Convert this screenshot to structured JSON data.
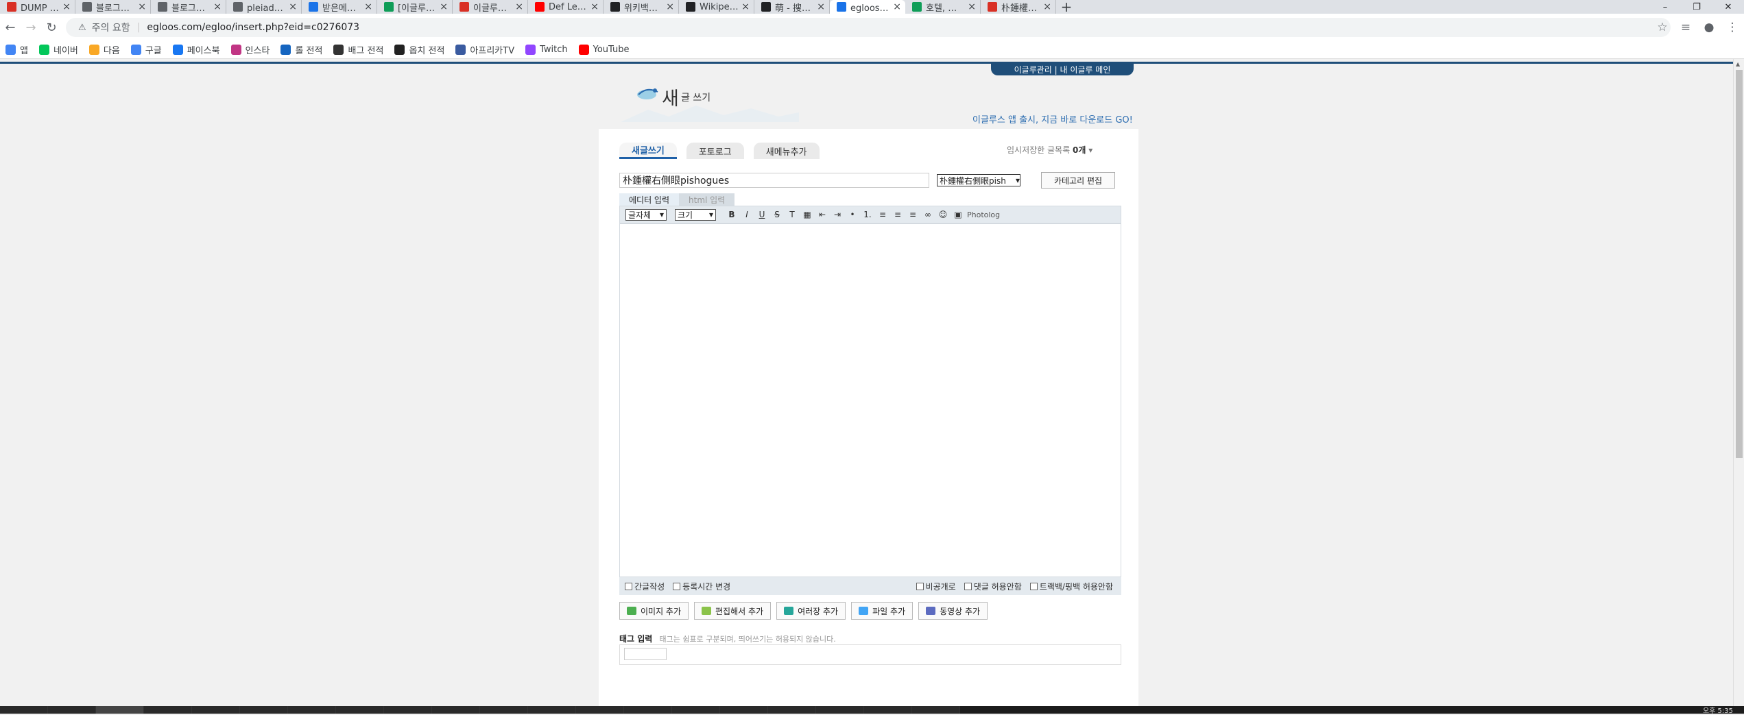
{
  "browser": {
    "tabs": [
      {
        "title": "DUMP PCK정상화",
        "color": "#d93025"
      },
      {
        "title": "블로그관리 | BLOG",
        "color": "#5f6368"
      },
      {
        "title": "블로그관리 | BLOG",
        "color": "#5f6368"
      },
      {
        "title": "pleiades聯邦紀傳",
        "color": "#5f6368"
      },
      {
        "title": "받은메일함 : Daum",
        "color": "#1a73e8"
      },
      {
        "title": "[이글루스] 확인 후",
        "color": "#0f9d58"
      },
      {
        "title": "이글루스 – 네이트",
        "color": "#d93025"
      },
      {
        "title": "Def Leppard",
        "color": "#ff0000"
      },
      {
        "title": "위키백과 – 위키백",
        "color": "#202124"
      },
      {
        "title": "Wikipedia – Wikipe",
        "color": "#202124"
      },
      {
        "title": "萌 - 搜索結果 - 維",
        "color": "#202124"
      },
      {
        "title": "egloos!! - 블로그",
        "color": "#1a73e8"
      },
      {
        "title": "호텔, 은하자유연",
        "color": "#0f9d58"
      },
      {
        "title": "朴鍾權朴英英朴",
        "color": "#d93025"
      }
    ],
    "active_tab_index": 11,
    "new_tab": "+",
    "security_label": "주의 요함",
    "url": "egloos.com/egloo/insert.php?eid=c0276073"
  },
  "bookmarks": [
    {
      "label": "앱",
      "color": "#4285f4"
    },
    {
      "label": "네이버",
      "color": "#03c75a"
    },
    {
      "label": "다음",
      "color": "#f9a825"
    },
    {
      "label": "구글",
      "color": "#4285f4"
    },
    {
      "label": "페이스북",
      "color": "#1877f2"
    },
    {
      "label": "인스타",
      "color": "#c13584"
    },
    {
      "label": "롤 전적",
      "color": "#1565c0"
    },
    {
      "label": "배그 전적",
      "color": "#333333"
    },
    {
      "label": "옵치 전적",
      "color": "#222222"
    },
    {
      "label": "아프리카TV",
      "color": "#3a5ba0"
    },
    {
      "label": "Twitch",
      "color": "#9146ff"
    },
    {
      "label": "YouTube",
      "color": "#ff0000"
    }
  ],
  "page": {
    "top_links": "이글루관리 | 내 이글루 메인",
    "header_title": "새",
    "header_subtitle": "글 쓰기",
    "promo": "이글루스 앱 출시, 지금 바로 다운로드 GO!",
    "tabs": [
      "새글쓰기",
      "포토로그",
      "새메뉴추가"
    ],
    "temp_save_label": "임시저장한 글목록",
    "temp_save_count": "0개",
    "post_title_value": "朴鍾權右側眼pishogues",
    "category_value": "朴鍾權右側眼pish",
    "category_edit_button": "카테고리 편집",
    "mode_tabs": [
      "에디터 입력",
      "html 입력"
    ],
    "font_select": "글자체",
    "size_select": "크기",
    "photolog_label": "Photolog",
    "options_left": [
      "간글작성",
      "등록시간 변경"
    ],
    "options_right": [
      "비공개로",
      "댓글 허용안함",
      "트랙백/핑백 허용안함"
    ],
    "attach_buttons": [
      {
        "label": "이미지 추가",
        "color": "#4caf50"
      },
      {
        "label": "편집해서 추가",
        "color": "#8bc34a"
      },
      {
        "label": "여러장 추가",
        "color": "#26a69a"
      },
      {
        "label": "파일 추가",
        "color": "#42a5f5"
      },
      {
        "label": "동영상 추가",
        "color": "#5c6bc0"
      }
    ],
    "tag_label": "태그 입력",
    "tag_help": "태그는 쉼표로 구분되며, 띄어쓰기는 허용되지 않습니다."
  },
  "taskbar": {
    "clock": "오후 5:35"
  }
}
